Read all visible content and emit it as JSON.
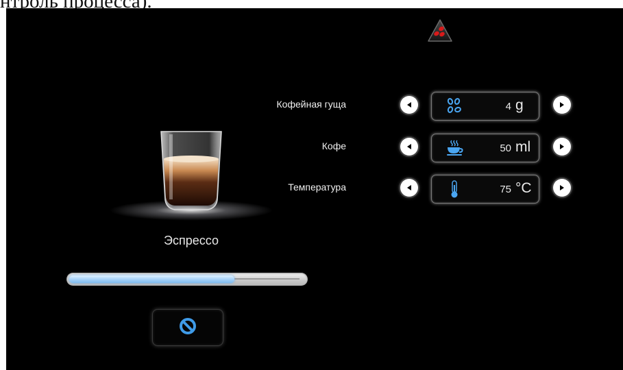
{
  "caption": "нтроль процесса).",
  "product": {
    "name": "Эспрессо",
    "progress": 0.7
  },
  "settings": [
    {
      "label": "Кофейная гуща",
      "value": "4",
      "unit": "g",
      "icon": "coffee-beans-icon"
    },
    {
      "label": "Кофе",
      "value": "50",
      "unit": "ml",
      "icon": "coffee-cup-icon"
    },
    {
      "label": "Температура",
      "value": "75",
      "unit": "°C",
      "icon": "thermometer-icon"
    }
  ],
  "icons": {
    "status": "beans-warning-icon",
    "cancel": "cancel-icon",
    "left_arrow": "left-arrow-icon",
    "right_arrow": "right-arrow-icon"
  },
  "colors": {
    "background": "#000000",
    "accent_blue": "#3f9be8",
    "warning_red": "#d81a1a"
  }
}
